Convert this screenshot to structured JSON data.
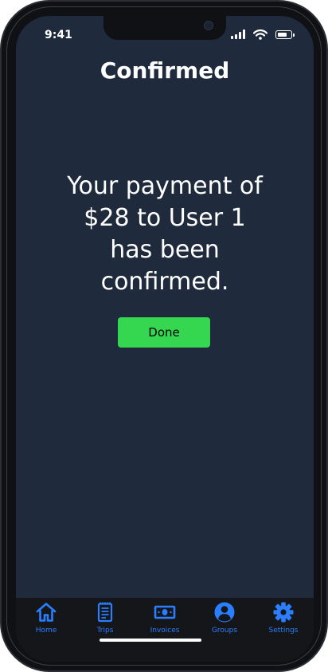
{
  "status_bar": {
    "time": "9:41"
  },
  "page": {
    "title": "Confirmed",
    "message_lines": [
      "Your payment of",
      "$28 to User 1",
      "has been",
      "confirmed."
    ],
    "done_label": "Done"
  },
  "tab_bar": {
    "accent_color": "#2b7fff",
    "items": [
      {
        "label": "Home",
        "icon": "home-icon"
      },
      {
        "label": "Trips",
        "icon": "clipboard-icon"
      },
      {
        "label": "Invoices",
        "icon": "cash-icon"
      },
      {
        "label": "Groups",
        "icon": "user-circle-icon"
      },
      {
        "label": "Settings",
        "icon": "gear-icon"
      }
    ]
  },
  "colors": {
    "screen_bg": "#1f2a3c",
    "done_button": "#34d74f",
    "tab_bar_bg": "#141619"
  }
}
